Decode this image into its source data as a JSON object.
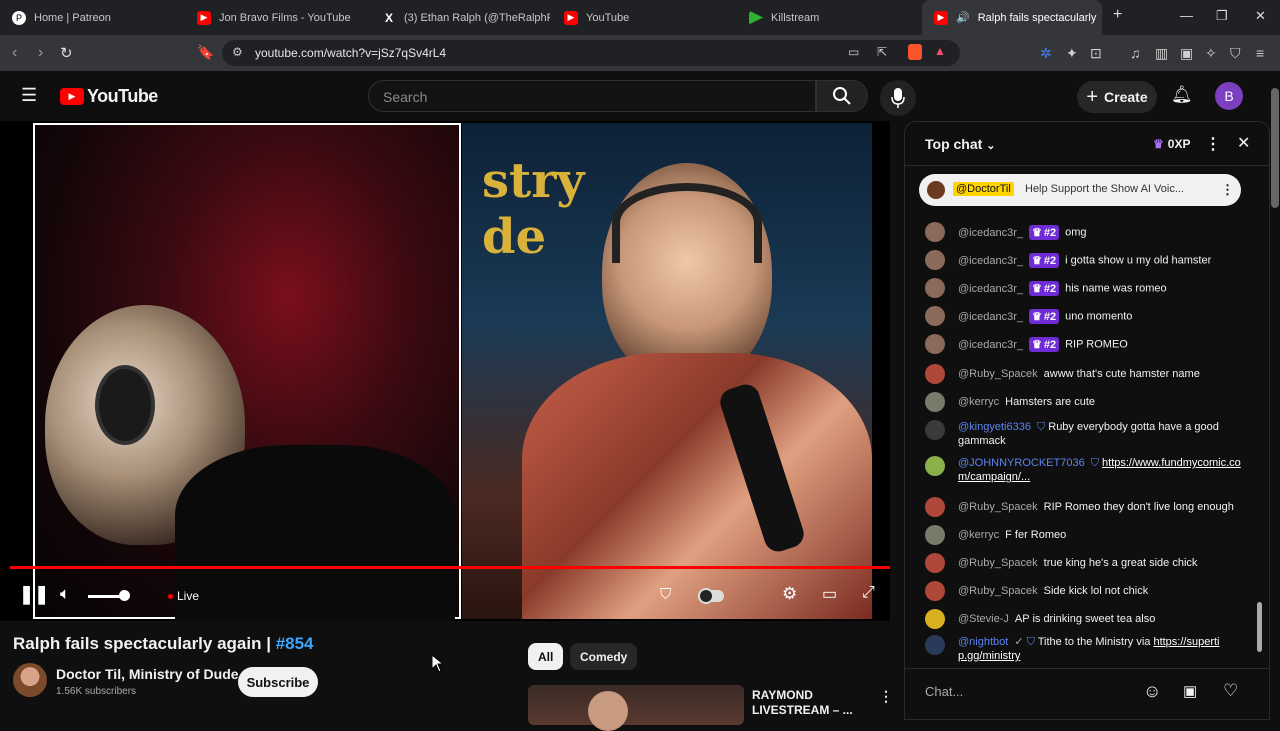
{
  "browser": {
    "tabs": [
      {
        "title": "Home | Patreon",
        "favicon": "patreon-icon",
        "active": false
      },
      {
        "title": "Jon Bravo Films - YouTube",
        "favicon": "youtube-icon",
        "active": false
      },
      {
        "title": "(3) Ethan Ralph (@TheRalphReto",
        "favicon": "x-icon",
        "active": false
      },
      {
        "title": "YouTube",
        "favicon": "youtube-icon",
        "active": false
      },
      {
        "title": "Killstream",
        "favicon": "killstream-icon",
        "active": false
      },
      {
        "title": "Ralph fails spectacularly",
        "favicon": "youtube-icon",
        "active": true
      }
    ],
    "url": "youtube.com/watch?v=jSz7qSv4rL4"
  },
  "youtube": {
    "logo": "YouTube",
    "search_placeholder": "Search",
    "create_label": "Create",
    "avatar_letter": "B"
  },
  "player": {
    "live_label": "Live",
    "progress": 1.0
  },
  "video": {
    "title": "Ralph fails spectacularly again | ",
    "hashtag": "#854",
    "channel_name": "Doctor Til, Ministry of Dude",
    "subscribers": "1.56K subscribers",
    "subscribe_label": "Subscribe"
  },
  "recommendations": {
    "chips": [
      "All",
      "Comedy"
    ],
    "first_title": "RAYMOND LIVESTREAM – ..."
  },
  "chat": {
    "header": "Top chat",
    "xp": "0XP",
    "pinned": {
      "author": "@DoctorTil",
      "text": "Help Support the Show AI Voic..."
    },
    "messages": [
      {
        "author": "@icedanc3r_",
        "badge": "#2",
        "text": "omg"
      },
      {
        "author": "@icedanc3r_",
        "badge": "#2",
        "text": "i gotta show u my old hamster"
      },
      {
        "author": "@icedanc3r_",
        "badge": "#2",
        "text": "his name was romeo"
      },
      {
        "author": "@icedanc3r_",
        "badge": "#2",
        "text": "uno momento"
      },
      {
        "author": "@icedanc3r_",
        "badge": "#2",
        "text": "RIP ROMEO"
      },
      {
        "author": "@Ruby_Spacek",
        "badge": "",
        "text": "awww that's cute hamster name"
      },
      {
        "author": "@kerryc",
        "badge": "",
        "text": "Hamsters are cute"
      },
      {
        "author": "@kingyeti6336",
        "badge": "",
        "text": "Ruby everybody gotta have a good gammack"
      },
      {
        "author": "@JOHNNYROCKET7036",
        "badge": "",
        "text": "https://www.fundmycomic.com/campaign/..."
      },
      {
        "author": "@Ruby_Spacek",
        "badge": "",
        "text": "RIP Romeo they don't live long enough"
      },
      {
        "author": "@kerryc",
        "badge": "",
        "text": "F fer Romeo"
      },
      {
        "author": "@Ruby_Spacek",
        "badge": "",
        "text": "true king he's a great side chick"
      },
      {
        "author": "@Ruby_Spacek",
        "badge": "",
        "text": "Side kick lol not chick"
      },
      {
        "author": "@Stevie-J",
        "badge": "",
        "text": "AP is drinking sweet tea also"
      },
      {
        "author": "@nightbot",
        "badge": "",
        "text": "Tithe to the Ministry via ",
        "link": "https://superti p.gg/ministry"
      }
    ],
    "input_placeholder": "Chat..."
  },
  "colors": {
    "accent_red": "#ff0000",
    "member_badge": "#6f2bd6",
    "link_blue": "#3ea6ff"
  }
}
